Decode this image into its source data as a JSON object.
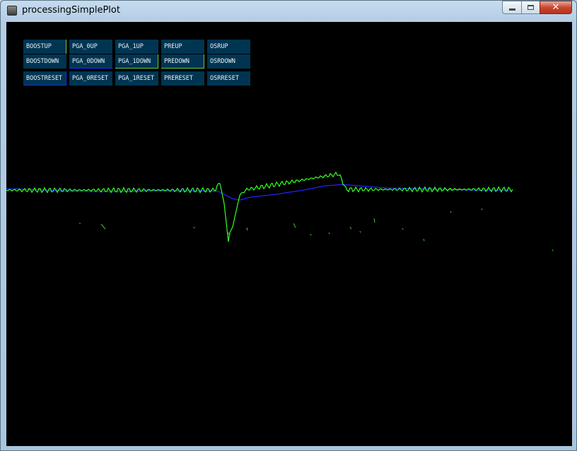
{
  "window": {
    "title": "processingSimplePlot",
    "minimize_label": "",
    "maximize_label": "",
    "close_label": "✕"
  },
  "controls": {
    "rows": [
      [
        "BOOSTUP",
        "PGA_0UP",
        "PGA_1UP",
        "PREUP",
        "OSRUP"
      ],
      [
        "BOOSTDOWN",
        "PGA_0DOWN",
        "PGA_1DOWN",
        "PREDOWN",
        "OSRDOWN"
      ],
      [
        "BOOSTRESET",
        "PGA_0RESET",
        "PGA_1RESET",
        "PRERESET",
        "OSRRESET"
      ]
    ]
  },
  "plot": {
    "colors": {
      "background": "#000000",
      "raw": "#33ff22",
      "filtered": "#2222ff",
      "button_bg": "#003552"
    }
  }
}
